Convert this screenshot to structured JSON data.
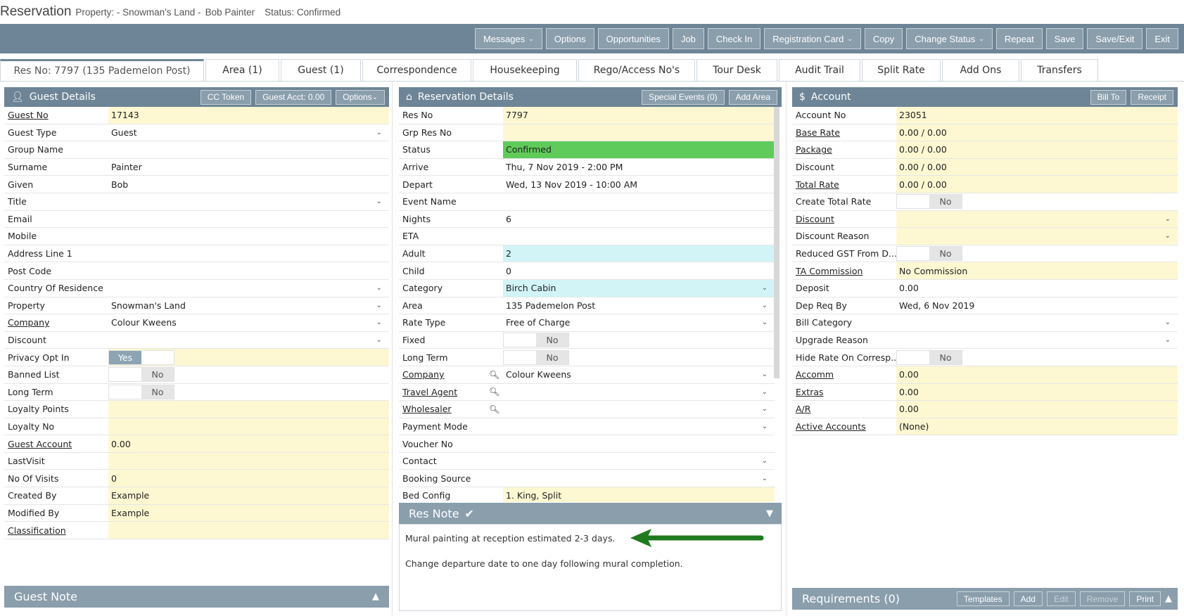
{
  "title": {
    "app": "Reservation",
    "property": "Property: - Snowman's Land -",
    "guest": "Bob Painter",
    "status": "Status: Confirmed"
  },
  "toolbar": [
    {
      "label": "Messages",
      "caret": true
    },
    {
      "label": "Options",
      "caret": false
    },
    {
      "label": "Opportunities",
      "caret": false
    },
    {
      "label": "Job",
      "caret": false
    },
    {
      "label": "Check In",
      "caret": false
    },
    {
      "label": "Registration Card",
      "caret": true
    },
    {
      "label": "Copy",
      "caret": false
    },
    {
      "label": "Change Status",
      "caret": true
    },
    {
      "label": "Repeat",
      "caret": false
    },
    {
      "label": "Save",
      "caret": false
    },
    {
      "label": "Save/Exit",
      "caret": false
    },
    {
      "label": "Exit",
      "caret": false
    }
  ],
  "tabs": [
    {
      "label": "Res No: 7797 (135 Pademelon Post)",
      "active": true
    },
    {
      "label": "Area (1)"
    },
    {
      "label": "Guest (1)"
    },
    {
      "label": "Correspondence"
    },
    {
      "label": "Housekeeping"
    },
    {
      "label": "Rego/Access No's"
    },
    {
      "label": "Tour Desk"
    },
    {
      "label": "Audit Trail"
    },
    {
      "label": "Split Rate"
    },
    {
      "label": "Add Ons"
    },
    {
      "label": "Transfers"
    }
  ],
  "guest_details": {
    "title": "Guest Details",
    "buttons": [
      "CC Token",
      "Guest Acct: 0.00",
      "Options"
    ],
    "rows": [
      {
        "label": "Guest No",
        "value": "17143",
        "link": true,
        "bg": "yellow"
      },
      {
        "label": "Guest Type",
        "value": "Guest",
        "dropdown": true
      },
      {
        "label": "Group Name",
        "value": ""
      },
      {
        "label": "Surname",
        "value": "Painter"
      },
      {
        "label": "Given",
        "value": "Bob"
      },
      {
        "label": "Title",
        "value": "",
        "dropdown": true
      },
      {
        "label": "Email",
        "value": ""
      },
      {
        "label": "Mobile",
        "value": ""
      },
      {
        "label": "Address Line 1",
        "value": ""
      },
      {
        "label": "Post Code",
        "value": ""
      },
      {
        "label": "Country Of Residence",
        "value": "",
        "dropdown": true
      },
      {
        "label": "Property",
        "value": "Snowman's Land",
        "dropdown": true
      },
      {
        "label": "Company",
        "value": "Colour Kweens",
        "link": true,
        "dropdown": true
      },
      {
        "label": "Discount",
        "value": "",
        "dropdown": true
      },
      {
        "label": "Privacy Opt In",
        "toggle": "Yes",
        "bg": "yellow"
      },
      {
        "label": "Banned List",
        "toggle": "No"
      },
      {
        "label": "Long Term",
        "toggle": "No"
      },
      {
        "label": "Loyalty Points",
        "value": "",
        "bg": "yellow"
      },
      {
        "label": "Loyalty No",
        "value": "",
        "bg": "yellow"
      },
      {
        "label": "Guest Account",
        "value": "0.00",
        "link": true,
        "bg": "yellow"
      },
      {
        "label": "LastVisit",
        "value": "",
        "bg": "yellow"
      },
      {
        "label": "No Of Visits",
        "value": "0",
        "bg": "yellow"
      },
      {
        "label": "Created By",
        "value": "Example",
        "bg": "yellow"
      },
      {
        "label": "Modified By",
        "value": "Example",
        "bg": "yellow"
      },
      {
        "label": "Classification",
        "value": "",
        "link": true,
        "bg": "yellow"
      }
    ]
  },
  "guest_note": {
    "title": "Guest Note"
  },
  "reservation_details": {
    "title": "Reservation Details",
    "buttons": [
      "Special Events (0)",
      "Add Area"
    ],
    "rows": [
      {
        "label": "Res No",
        "value": "7797",
        "bg": "yellow"
      },
      {
        "label": "Grp Res No",
        "value": "",
        "bg": "yellow"
      },
      {
        "label": "Status",
        "value": "Confirmed",
        "bg": "green"
      },
      {
        "label": "Arrive",
        "value": "Thu, 7 Nov 2019 - 2:00 PM"
      },
      {
        "label": "Depart",
        "value": "Wed, 13 Nov 2019 - 10:00 AM"
      },
      {
        "label": "Event Name",
        "value": ""
      },
      {
        "label": "Nights",
        "value": "6"
      },
      {
        "label": "ETA",
        "value": ""
      },
      {
        "label": "Adult",
        "value": "2",
        "bg": "cyan"
      },
      {
        "label": "Child",
        "value": "0"
      },
      {
        "label": "Category",
        "value": "Birch Cabin",
        "bg": "cyan",
        "dropdown": true
      },
      {
        "label": "Area",
        "value": "135 Pademelon Post",
        "dropdown": true
      },
      {
        "label": "Rate Type",
        "value": "Free of Charge",
        "dropdown": true
      },
      {
        "label": "Fixed",
        "toggle": "No"
      },
      {
        "label": "Long Term",
        "toggle": "No"
      },
      {
        "label": "Company",
        "value": "Colour Kweens",
        "link": true,
        "search": true,
        "dropdown": true
      },
      {
        "label": "Travel Agent",
        "value": "",
        "link": true,
        "search": true,
        "dropdown": true
      },
      {
        "label": "Wholesaler",
        "value": "",
        "link": true,
        "search": true,
        "dropdown": true
      },
      {
        "label": "Payment Mode",
        "value": "",
        "dropdown": true
      },
      {
        "label": "Voucher No",
        "value": ""
      },
      {
        "label": "Contact",
        "value": "",
        "dropdown": true
      },
      {
        "label": "Booking Source",
        "value": "",
        "dropdown": true
      },
      {
        "label": "Bed Config",
        "value": "1. King, Split",
        "bg": "yellow"
      }
    ]
  },
  "res_note": {
    "title": "Res Note",
    "line1": "Mural painting at reception estimated 2-3 days.",
    "line2": "Change departure date to one day following mural completion."
  },
  "account": {
    "title": "Account",
    "buttons": [
      "Bill To",
      "Receipt"
    ],
    "rows": [
      {
        "label": "Account No",
        "value": "23051",
        "bg": "yellow"
      },
      {
        "label": "Base Rate",
        "value": "0.00 / 0.00",
        "link": true,
        "bg": "yellow"
      },
      {
        "label": "Package",
        "value": "0.00 / 0.00",
        "link": true,
        "bg": "yellow"
      },
      {
        "label": "Discount",
        "value": "0.00 / 0.00",
        "bg": "yellow"
      },
      {
        "label": "Total Rate",
        "value": "0.00 / 0.00",
        "link": true,
        "bg": "yellow"
      },
      {
        "label": "Create Total Rate",
        "toggle": "No"
      },
      {
        "label": "Discount",
        "value": "",
        "link": true,
        "bg": "yellow",
        "dropdown": true
      },
      {
        "label": "Discount Reason",
        "value": "",
        "bg": "yellow",
        "dropdown": true
      },
      {
        "label": "Reduced GST From D...",
        "toggle": "No"
      },
      {
        "label": "TA Commission",
        "value": "No Commission",
        "link": true,
        "bg": "yellow"
      },
      {
        "label": "Deposit",
        "value": "0.00"
      },
      {
        "label": "Dep Req By",
        "value": "Wed, 6 Nov 2019"
      },
      {
        "label": "Bill Category",
        "value": "",
        "dropdown": true
      },
      {
        "label": "Upgrade Reason",
        "value": "",
        "dropdown": true
      },
      {
        "label": "Hide Rate On Corresp...",
        "toggle": "No"
      },
      {
        "label": "Accomm",
        "value": "0.00",
        "link": true,
        "bg": "yellow"
      },
      {
        "label": "Extras",
        "value": "0.00",
        "link": true,
        "bg": "yellow"
      },
      {
        "label": "A/R",
        "value": "0.00",
        "link": true,
        "bg": "yellow"
      },
      {
        "label": "Active Accounts",
        "value": "(None)",
        "link": true,
        "bg": "yellow"
      }
    ]
  },
  "requirements": {
    "title": "Requirements (0)",
    "buttons": [
      {
        "label": "Templates",
        "disabled": false
      },
      {
        "label": "Add",
        "disabled": false
      },
      {
        "label": "Edit",
        "disabled": true
      },
      {
        "label": "Remove",
        "disabled": true
      },
      {
        "label": "Print",
        "disabled": false
      }
    ]
  },
  "colors": {
    "header": "#6d8596",
    "button": "#8a9eac",
    "yellow": "#fdf8d2",
    "green": "#5fcb5a",
    "cyan": "#d2f4f7",
    "arrow": "#1f7a1f"
  }
}
